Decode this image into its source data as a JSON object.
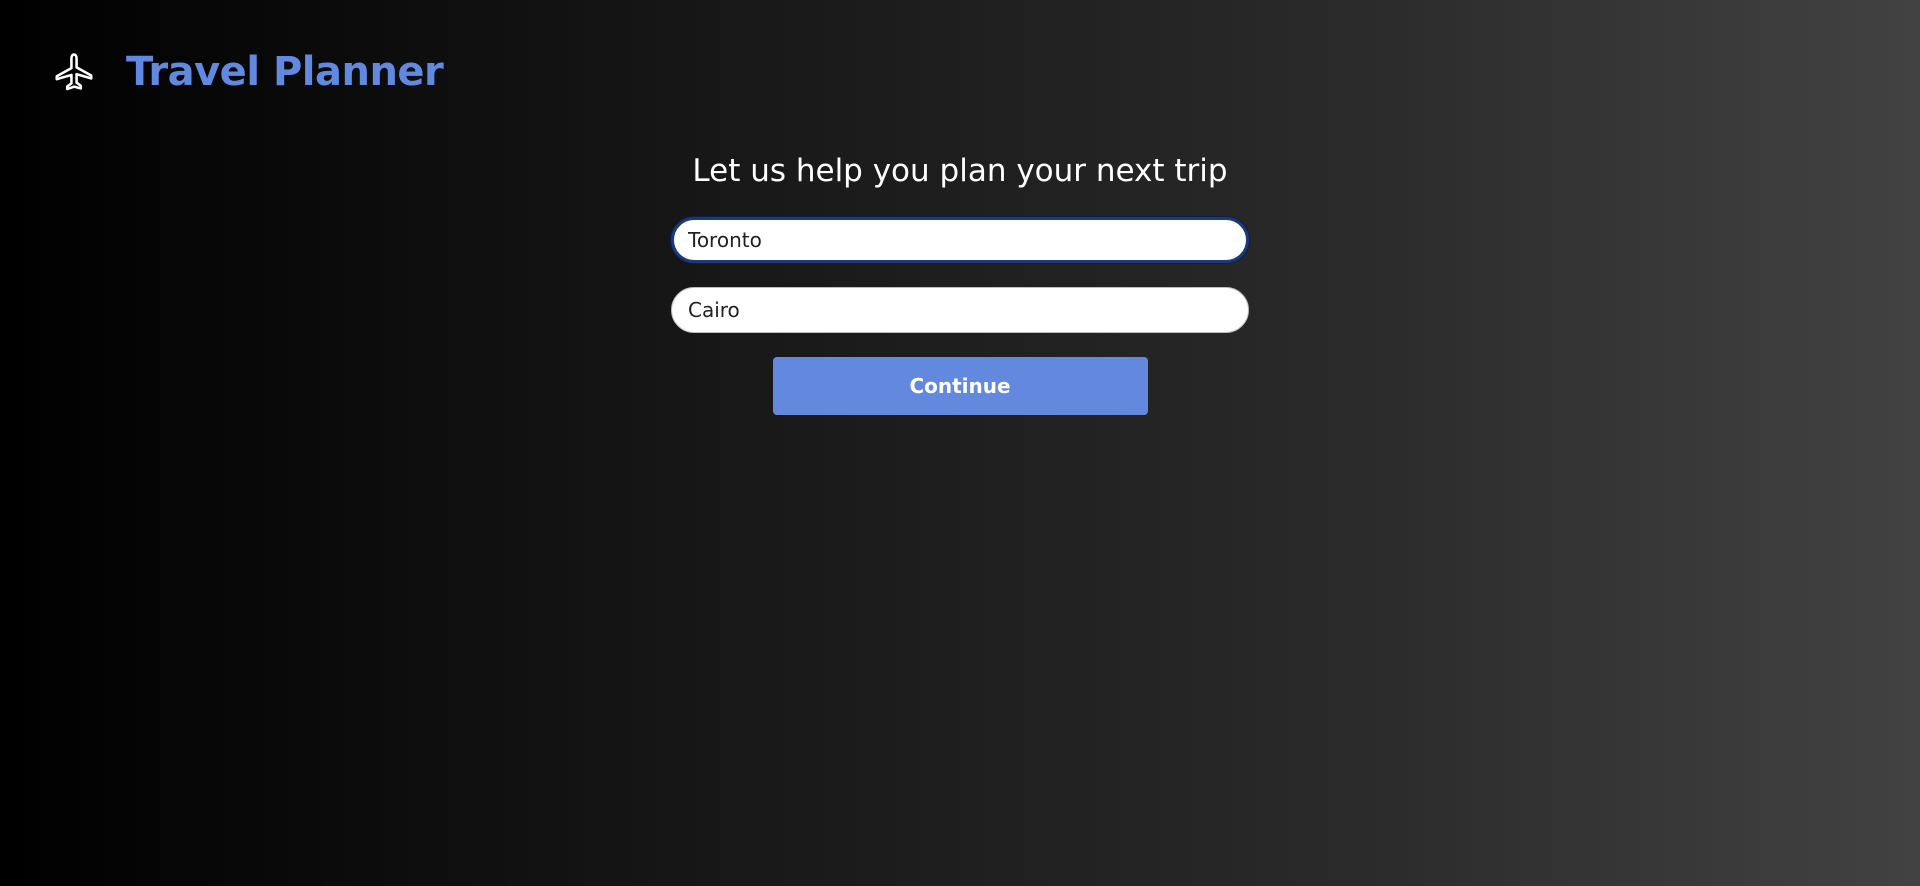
{
  "app": {
    "title": "Travel Planner",
    "logo_icon": "airplane-icon",
    "brand_color": "#6289e0"
  },
  "main": {
    "heading": "Let us help you plan your next trip",
    "origin_input": {
      "value": "Toronto",
      "focused": true
    },
    "destination_input": {
      "value": "Cairo",
      "focused": false
    },
    "continue_label": "Continue",
    "button_color": "#6289de"
  }
}
